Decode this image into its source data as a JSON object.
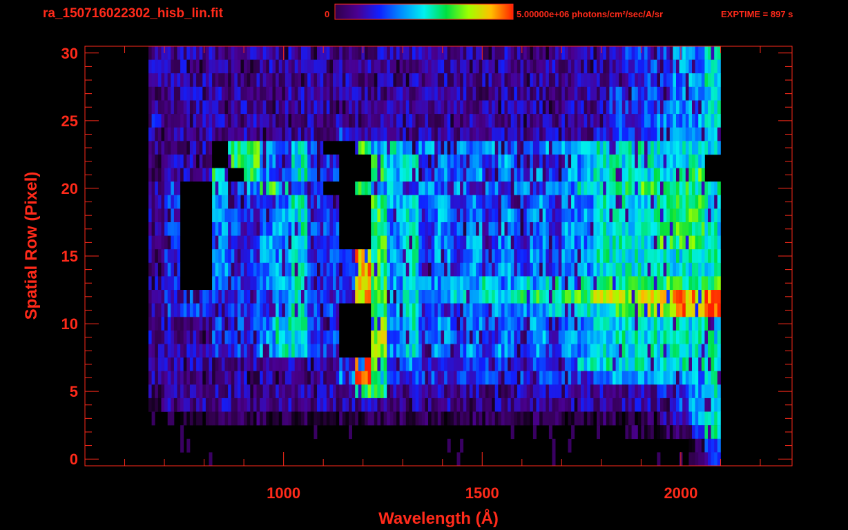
{
  "header": {
    "filename": "ra_150716022302_hisb_lin.fit",
    "colorbar_min_label": "0",
    "colorbar_max_label": "5.00000e+06 photons/cm²/sec/A/sr",
    "exptime": "EXPTIME = 897 s"
  },
  "colors": {
    "axis": "#ff2a1a",
    "background": "#000000"
  },
  "chart_data": {
    "type": "heatmap",
    "title": "ra_150716022302_hisb_lin.fit",
    "xlabel": "Wavelength (Å)",
    "ylabel": "Spatial Row (Pixel)",
    "xlim": [
      500,
      2280
    ],
    "ylim": [
      -0.5,
      30.5
    ],
    "x_major_ticks": [
      1000,
      1500,
      2000
    ],
    "x_tick_labels": [
      "1000",
      "1500",
      "2000"
    ],
    "x_minor_step": 100,
    "y_major_ticks": [
      0,
      5,
      10,
      15,
      20,
      25,
      30
    ],
    "y_tick_labels": [
      "0",
      "5",
      "10",
      "15",
      "20",
      "25",
      "30"
    ],
    "y_minor_step": 1,
    "colorbar": {
      "min": 0,
      "max": 5000000,
      "units": "photons/cm²/sec/A/sr",
      "colormap": [
        "#000000",
        "#30004a",
        "#4a0090",
        "#1020ff",
        "#0090ff",
        "#00f0f0",
        "#00e040",
        "#a0ff00",
        "#ffc000",
        "#ff2000"
      ]
    },
    "bin_start_wavelength": 660,
    "bin_width": 40,
    "level_scale": "digit 0-9 = fraction 0-1 of colorbar max; x = masked (no data)",
    "rows_top_to_bottom": [
      "222222222222222222222222222222333445",
      "222222222222222222222222222222333445",
      "222222222222222222222222222222333445",
      "222222222222222222222222222223333445",
      "222222222222222222222222222223334445",
      "322222222222222222222222222223334445",
      "222222222222322222222222222233334445",
      "2222x664353xx645343434343445555555554",
      "2222x66435 33xx645343434343445555555",
      "22226x6435 33xx645343434343445555556",
      "23xx5346533xx64534343434344555666655",
      "23xx43334533xx6453434343434455556665",
      "23xx43334533xx6453434343434455556665",
      "23xx43344533xx6453434343434455556665",
      "23xx43344533xx6453434343434455556665",
      "23xx43344533386453434343434455555555",
      "23xx43344533386453434343434455555555",
      "23xx43344533386454454545454566666666",
      "233333334533386454455556666677788889",
      "233333334533xx6453334444455556677889",
      "222233345533xx7453434343434455555555",
      "222233345533xx7453434343434455555555",
      "222233345533xx7453434343434455555555",
      "222222222222396343333333333555555555",
      "222222222222495333333333333344444445",
      "222222222222266222222222222222223345",
      "122222222222222222222222222222222345",
      "001111111111111111111111111111112245",
      "000000000000000000000000000000111235",
      "000000000000000000000000000000000013",
      "000000000000000000000000000000000013"
    ]
  }
}
